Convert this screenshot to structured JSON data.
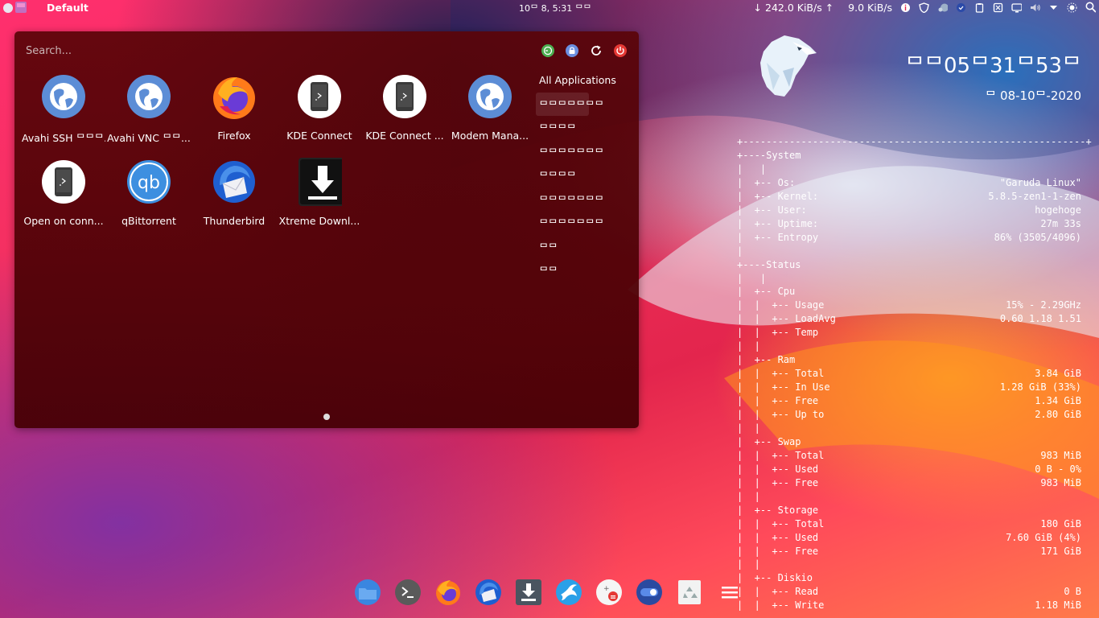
{
  "top_panel": {
    "workspace_label": "Default",
    "clock": "10ᄆ 8, 5:31 ᄆᄆ",
    "download_speed": "↓ 242.0 KiB/s ↑",
    "upload_speed": "9.0 KiB/s",
    "tray_icons": [
      "info-icon",
      "shield-icon",
      "steam-icon",
      "updates-icon",
      "clipboard-icon",
      "kde-connect-icon",
      "display-icon",
      "volume-icon",
      "caret-down-icon",
      "brightness-icon",
      "search-icon"
    ]
  },
  "launcher": {
    "search_placeholder": "Search...",
    "actions": [
      "leave-icon",
      "lock-icon",
      "restart-icon",
      "power-icon"
    ],
    "apps": [
      {
        "label": "Avahi SSH ᄆᄆᄆ...",
        "icon": "globe-icon"
      },
      {
        "label": "Avahi VNC ᄆᄆ...",
        "icon": "globe-icon"
      },
      {
        "label": "Firefox",
        "icon": "firefox-icon"
      },
      {
        "label": "KDE Connect",
        "icon": "kde-connect-icon"
      },
      {
        "label": "KDE Connect ...",
        "icon": "kde-connect-icon"
      },
      {
        "label": "Modem Mana...",
        "icon": "globe-icon"
      },
      {
        "label": "Open on conn...",
        "icon": "kde-connect-icon"
      },
      {
        "label": "qBittorrent",
        "icon": "qbittorrent-icon"
      },
      {
        "label": "Thunderbird",
        "icon": "thunderbird-icon"
      },
      {
        "label": "Xtreme Downl...",
        "icon": "download-icon"
      }
    ],
    "categories": [
      "All Applications",
      "ᄆᄆᄆᄆᄆᄆᄆ",
      "ᄆᄆᄆᄆ",
      "ᄆᄆᄆᄆᄆᄆᄆ",
      "ᄆᄆᄆᄆ",
      "ᄆᄆᄆᄆᄆᄆᄆ",
      "ᄆᄆᄆᄆᄆᄆᄆ",
      "ᄆᄆ",
      "ᄆᄆ"
    ],
    "selected_category": 1
  },
  "clock_widget": {
    "time": "ᄆᄆ05ᄆ31ᄆ53ᄆ",
    "date": "ᄆ 08-10ᄆ-2020"
  },
  "conky": {
    "lines": [
      {
        "text": "+-----------------------------------------------------------+",
        "value": ""
      },
      {
        "text": "+----System",
        "value": ""
      },
      {
        "text": "|   |",
        "value": ""
      },
      {
        "text": "|  +-- Os:",
        "value": "\"Garuda Linux\""
      },
      {
        "text": "|  +-- Kernel:",
        "value": "5.8.5-zen1-1-zen"
      },
      {
        "text": "|  +-- User:",
        "value": "hogehoge"
      },
      {
        "text": "|  +-- Uptime:",
        "value": "27m 33s"
      },
      {
        "text": "|  +-- Entropy",
        "value": "86% (3505/4096)"
      },
      {
        "text": "|",
        "value": ""
      },
      {
        "text": "+----Status",
        "value": ""
      },
      {
        "text": "|   |",
        "value": ""
      },
      {
        "text": "|  +-- Cpu",
        "value": ""
      },
      {
        "text": "|  |  +-- Usage",
        "value": "15% - 2.29GHz"
      },
      {
        "text": "|  |  +-- LoadAvg",
        "value": "0.60 1.18 1.51"
      },
      {
        "text": "|  |  +-- Temp",
        "value": ""
      },
      {
        "text": "|  |",
        "value": ""
      },
      {
        "text": "|  +-- Ram",
        "value": ""
      },
      {
        "text": "|  |  +-- Total",
        "value": "3.84 GiB"
      },
      {
        "text": "|  |  +-- In Use",
        "value": "1.28 GiB (33%)"
      },
      {
        "text": "|  |  +-- Free",
        "value": "1.34 GiB"
      },
      {
        "text": "|  |  +-- Up to",
        "value": "2.80 GiB"
      },
      {
        "text": "|  |",
        "value": ""
      },
      {
        "text": "|  +-- Swap",
        "value": ""
      },
      {
        "text": "|  |  +-- Total",
        "value": "983 MiB"
      },
      {
        "text": "|  |  +-- Used",
        "value": "0 B - 0%"
      },
      {
        "text": "|  |  +-- Free",
        "value": "983 MiB"
      },
      {
        "text": "|  |",
        "value": ""
      },
      {
        "text": "|  +-- Storage",
        "value": ""
      },
      {
        "text": "|  |  +-- Total",
        "value": "180 GiB"
      },
      {
        "text": "|  |  +-- Used",
        "value": "7.60 GiB (4%)"
      },
      {
        "text": "|  |  +-- Free",
        "value": "171 GiB"
      },
      {
        "text": "|  |",
        "value": ""
      },
      {
        "text": "|  +-- Diskio",
        "value": ""
      },
      {
        "text": "|  |  +-- Read",
        "value": "0 B"
      },
      {
        "text": "|  |  +-- Write",
        "value": "1.18 MiB"
      }
    ]
  },
  "dock": {
    "items": [
      "file-manager-icon",
      "terminal-icon",
      "firefox-icon",
      "thunderbird-icon",
      "downloader-icon",
      "swift-icon",
      "calculator-icon",
      "toggle-icon",
      "trash-icon",
      "menu-icon"
    ]
  },
  "colors": {
    "menu_bg": "#5a0408",
    "accent_green": "#4caf50",
    "accent_red": "#e53935",
    "accent_blue": "#5c8dd6"
  }
}
